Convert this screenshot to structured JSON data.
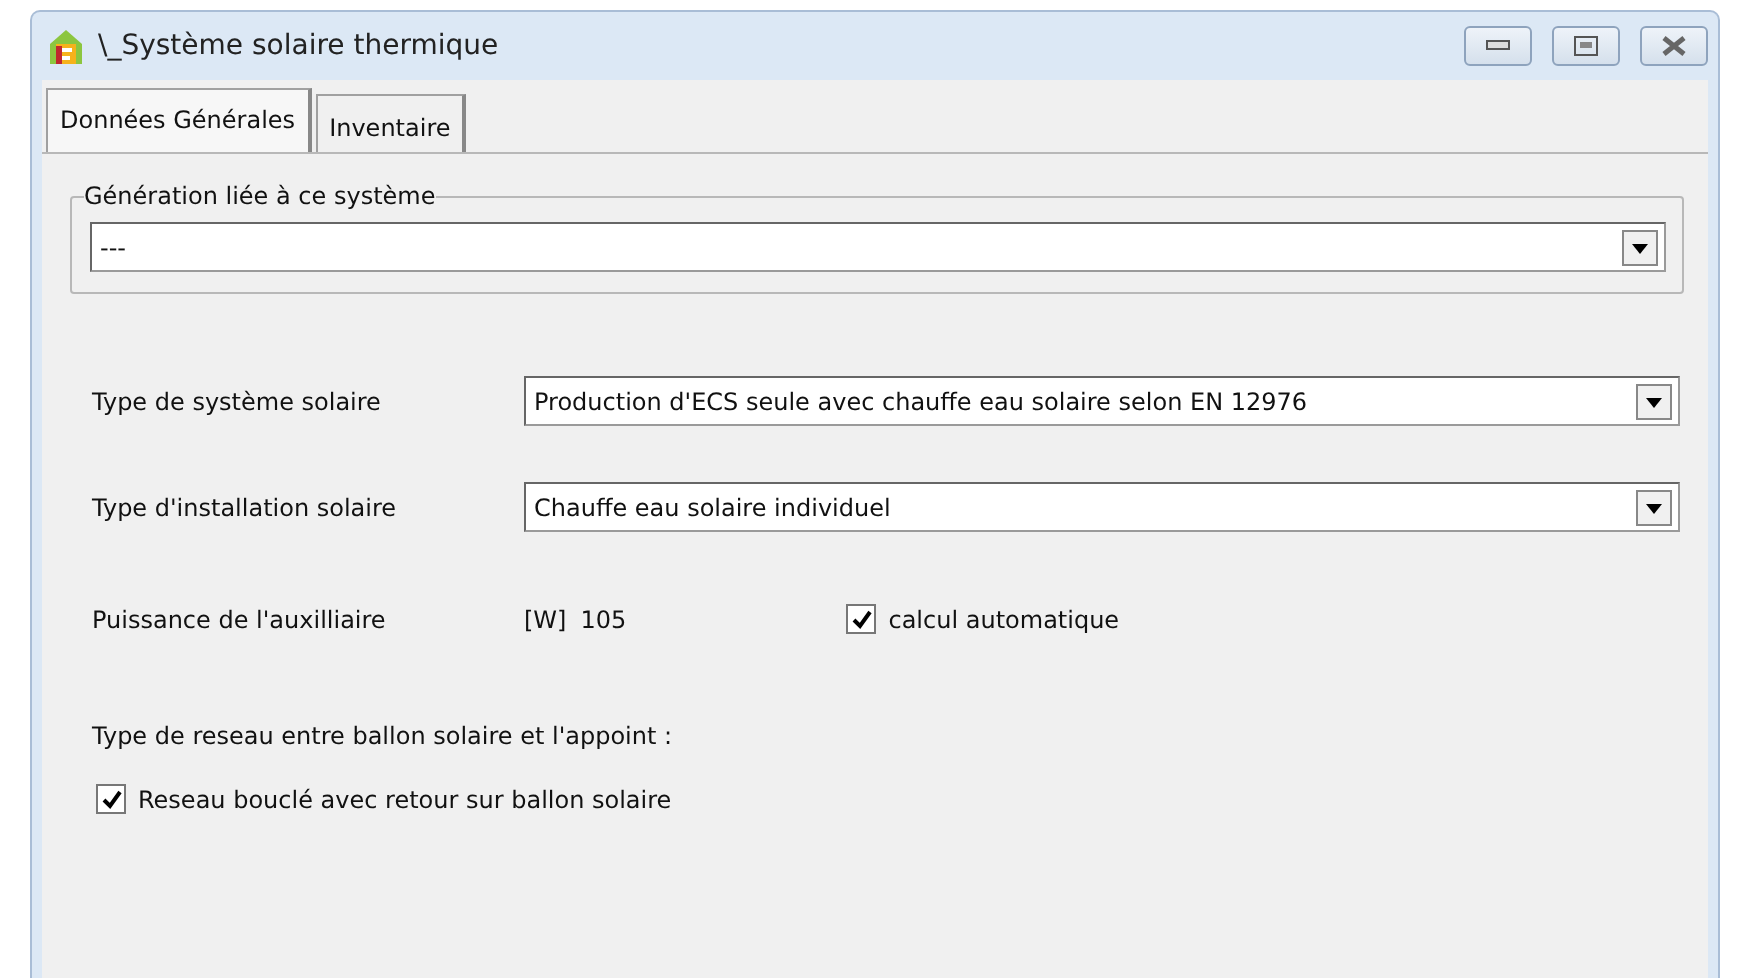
{
  "window": {
    "title": "\\_Système solaire thermique"
  },
  "tabs": [
    {
      "label": "Données Générales",
      "selected": true
    },
    {
      "label": "Inventaire",
      "selected": false
    }
  ],
  "generation_group": {
    "legend": "Génération liée à ce système",
    "value": "---"
  },
  "fields": [
    {
      "label": "Type de système solaire",
      "value": "Production d'ECS seule avec chauffe eau solaire selon EN 12976"
    },
    {
      "label": "Type d'installation solaire",
      "value": "Chauffe eau solaire individuel"
    }
  ],
  "auxiliary_power": {
    "label": "Puissance de l'auxilliaire",
    "unit": "[W]",
    "value": "105",
    "auto": {
      "label": "calcul automatique",
      "checked": true
    }
  },
  "network": {
    "heading": "Type de reseau entre ballon solaire et l'appoint :",
    "option": {
      "label": "Reseau bouclé avec retour sur ballon solaire",
      "checked": true
    }
  }
}
